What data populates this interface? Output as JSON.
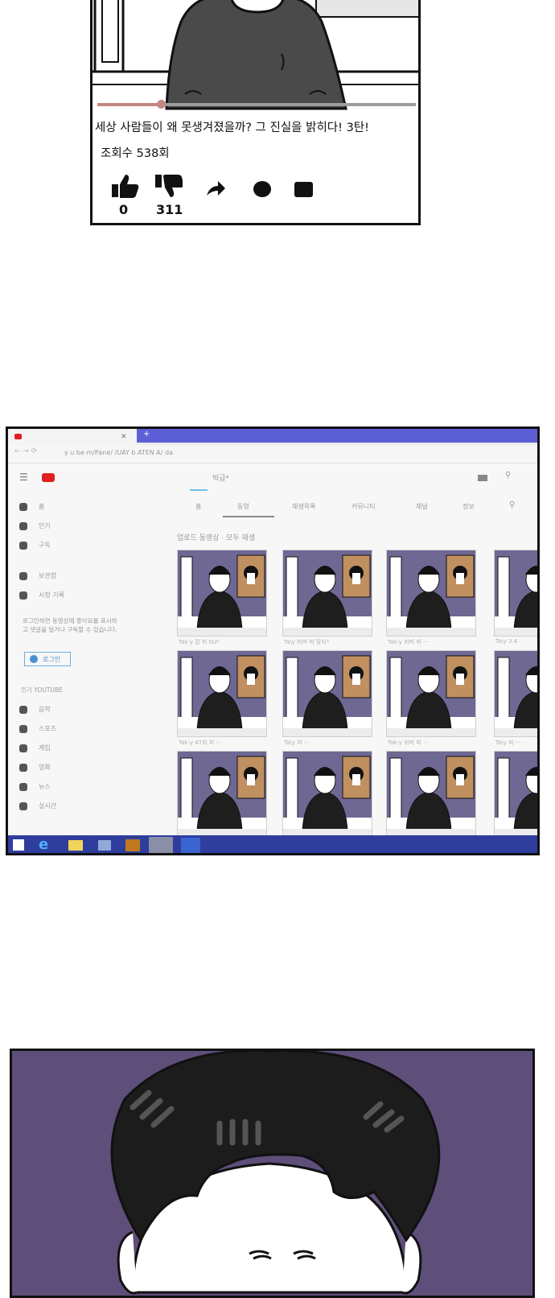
{
  "panel1": {
    "caption": "세상 사람들이 왜 못생겨졌을까? 그 진실을 밝히다! 3탄!",
    "views": "조회수 538회",
    "like_count": "0",
    "dislike_count": "311",
    "icons": [
      "thumbs-up-icon",
      "thumbs-down-icon",
      "share-icon",
      "circle-icon",
      "square-icon"
    ],
    "progress": 0.2
  },
  "panel2": {
    "header_search": "빅급*",
    "channel_tabs": [
      "홈",
      "동영",
      "재생목록",
      "커뮤니티",
      "채널",
      "정보"
    ],
    "grid_title": "업로드 동영상 · 모두 재생",
    "sidebar_items": [
      "홈",
      "인기",
      "구독",
      "보관함",
      "시청 기록"
    ],
    "sidebar_note": "로그인하면 동영상에 좋아요를 표시하고 댓글을 달거나 구독할 수 있습니다.",
    "login_label": "로그인",
    "sidebar_section": "인기 YOUTUBE",
    "sidebar_section_items": [
      "음악",
      "스포츠",
      "게임",
      "영화",
      "뉴스",
      "실시간"
    ],
    "thumb_labels": [
      "Tak-y 잡 피 0U*",
      "Ta\\y 비버 피 맞지*",
      "Tak-y 비버 피 ···",
      "Ta\\y 3.4",
      "Tak-y 47회 피 ···",
      "Ta\\y 피 ···",
      "Tak-y 비버 피 ···",
      "Ta\\y 피 ···"
    ],
    "colors": {
      "accent": "#5d5fd6",
      "taskbar": "#2f3e9c",
      "thumb_bg": "#6e6893"
    }
  },
  "panel3": {
    "colors": {
      "background": "#5e4e7a",
      "hair": "#1a1a1a"
    }
  }
}
